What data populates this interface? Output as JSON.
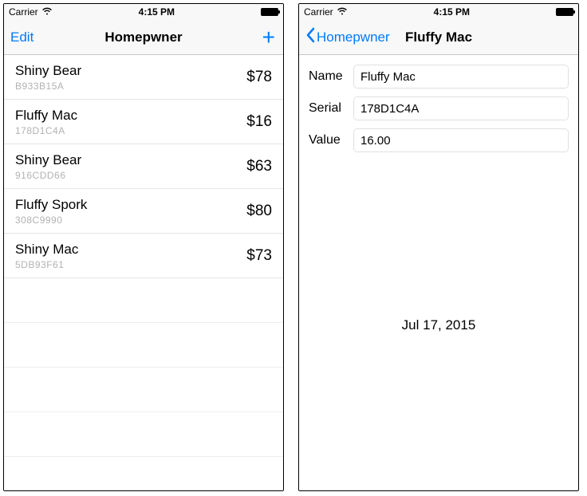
{
  "status": {
    "carrier": "Carrier",
    "time": "4:15 PM"
  },
  "list_screen": {
    "nav": {
      "left": "Edit",
      "title": "Homepwner"
    },
    "items": [
      {
        "name": "Shiny Bear",
        "serial": "B933B15A",
        "price": "$78"
      },
      {
        "name": "Fluffy Mac",
        "serial": "178D1C4A",
        "price": "$16"
      },
      {
        "name": "Shiny Bear",
        "serial": "916CDD66",
        "price": "$63"
      },
      {
        "name": "Fluffy Spork",
        "serial": "308C9990",
        "price": "$80"
      },
      {
        "name": "Shiny Mac",
        "serial": "5DB93F61",
        "price": "$73"
      }
    ]
  },
  "detail_screen": {
    "nav": {
      "back": "Homepwner",
      "title": "Fluffy Mac"
    },
    "labels": {
      "name": "Name",
      "serial": "Serial",
      "value": "Value"
    },
    "fields": {
      "name": "Fluffy Mac",
      "serial": "178D1C4A",
      "value": "16.00"
    },
    "date": "Jul 17, 2015"
  }
}
